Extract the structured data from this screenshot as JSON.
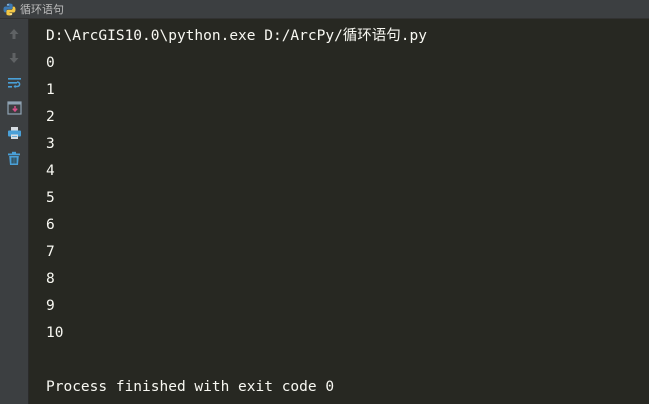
{
  "window": {
    "title": "循环语句",
    "title_icon": "python-icon"
  },
  "toolbar": {
    "buttons": [
      {
        "icon": "arrow-up-icon",
        "label": "Up to previous occurrence"
      },
      {
        "icon": "arrow-down-icon",
        "label": "Down to next occurrence"
      },
      {
        "icon": "soft-wrap-icon",
        "label": "Use soft wraps"
      },
      {
        "icon": "scroll-to-end-icon",
        "label": "Scroll to the end"
      },
      {
        "icon": "print-icon",
        "label": "Print"
      },
      {
        "icon": "trash-icon",
        "label": "Clear all"
      }
    ]
  },
  "console": {
    "command": "D:\\ArcGIS10.0\\python.exe D:/ArcPy/循环语句.py",
    "output": [
      "0",
      "1",
      "2",
      "3",
      "4",
      "5",
      "6",
      "7",
      "8",
      "9",
      "10"
    ],
    "exit_message": "Process finished with exit code 0"
  },
  "colors": {
    "console_bg": "#272822",
    "console_text": "#f8f8f2",
    "panel_bg": "#3c3f41",
    "icon_blue": "#4aa0d8"
  }
}
